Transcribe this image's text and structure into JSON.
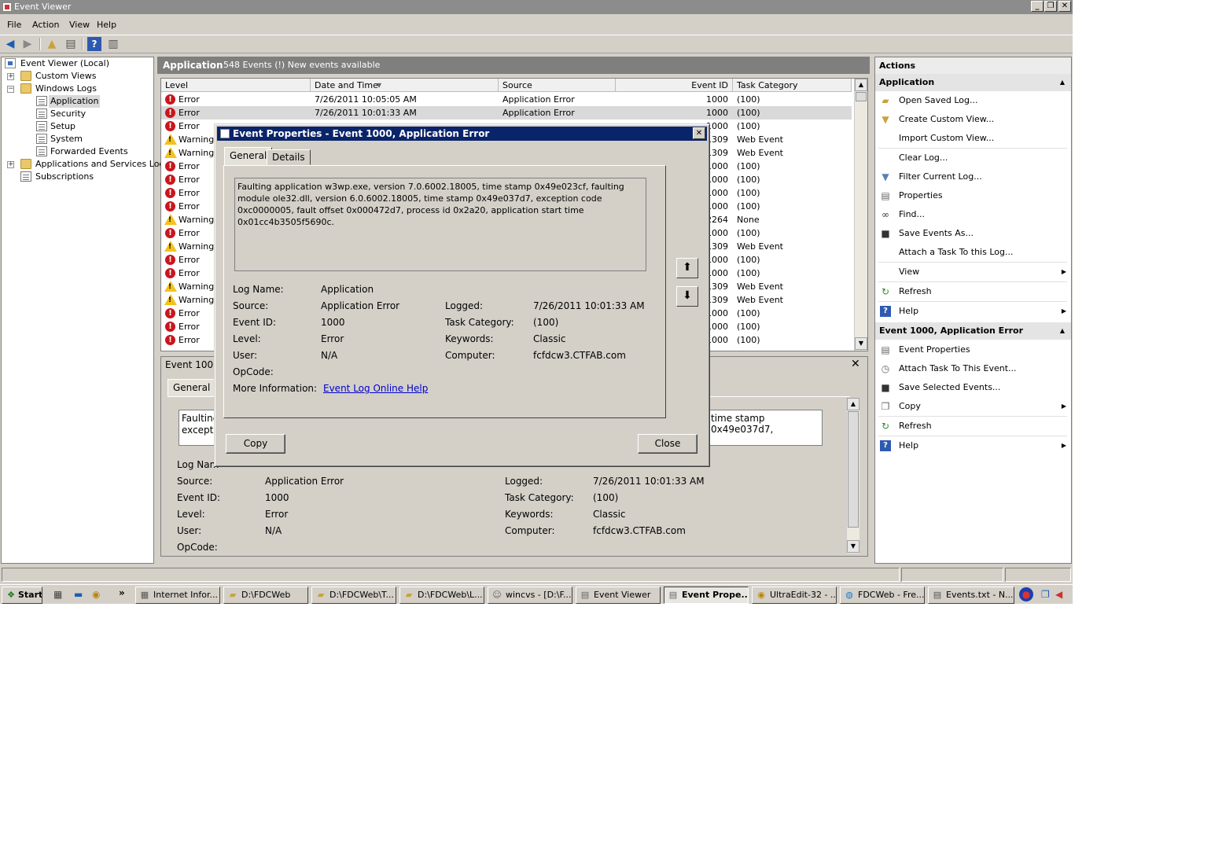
{
  "window": {
    "title": "Event Viewer"
  },
  "menu": [
    "File",
    "Action",
    "View",
    "Help"
  ],
  "tree": {
    "root": "Event Viewer (Local)",
    "custom_views": "Custom Views",
    "windows_logs": "Windows Logs",
    "logs": [
      "Application",
      "Security",
      "Setup",
      "System",
      "Forwarded Events"
    ],
    "apps_services": "Applications and Services Logs",
    "subscriptions": "Subscriptions"
  },
  "center": {
    "title": "Application",
    "subtitle": "548 Events (!) New events available"
  },
  "grid": {
    "columns": [
      "Level",
      "Date and Time",
      "Source",
      "Event ID",
      "Task Category"
    ],
    "rows": [
      {
        "level": "Error",
        "date": "7/26/2011 10:05:05 AM",
        "source": "Application Error",
        "id": "1000",
        "category": "(100)"
      },
      {
        "level": "Error",
        "date": "7/26/2011 10:01:33 AM",
        "source": "Application Error",
        "id": "1000",
        "category": "(100)"
      },
      {
        "level": "Error",
        "date": "",
        "source": "",
        "id": "1000",
        "category": "(100)"
      },
      {
        "level": "Warning",
        "date": "",
        "source": "",
        "id": "1309",
        "category": "Web Event"
      },
      {
        "level": "Warning",
        "date": "",
        "source": "",
        "id": "1309",
        "category": "Web Event"
      },
      {
        "level": "Error",
        "date": "",
        "source": "",
        "id": "1000",
        "category": "(100)"
      },
      {
        "level": "Error",
        "date": "",
        "source": "",
        "id": "1000",
        "category": "(100)"
      },
      {
        "level": "Error",
        "date": "",
        "source": "",
        "id": "1000",
        "category": "(100)"
      },
      {
        "level": "Error",
        "date": "",
        "source": "",
        "id": "1000",
        "category": "(100)"
      },
      {
        "level": "Warning",
        "date": "",
        "source": "",
        "id": "2264",
        "category": "None"
      },
      {
        "level": "Error",
        "date": "",
        "source": "",
        "id": "1000",
        "category": "(100)"
      },
      {
        "level": "Warning",
        "date": "",
        "source": "",
        "id": "1309",
        "category": "Web Event"
      },
      {
        "level": "Error",
        "date": "",
        "source": "",
        "id": "1000",
        "category": "(100)"
      },
      {
        "level": "Error",
        "date": "",
        "source": "",
        "id": "1000",
        "category": "(100)"
      },
      {
        "level": "Warning",
        "date": "",
        "source": "",
        "id": "1309",
        "category": "Web Event"
      },
      {
        "level": "Warning",
        "date": "",
        "source": "",
        "id": "1309",
        "category": "Web Event"
      },
      {
        "level": "Error",
        "date": "",
        "source": "",
        "id": "1000",
        "category": "(100)"
      },
      {
        "level": "Error",
        "date": "",
        "source": "",
        "id": "1000",
        "category": "(100)"
      },
      {
        "level": "Error",
        "date": "",
        "source": "",
        "id": "1000",
        "category": "(100)"
      }
    ]
  },
  "detail": {
    "header": "Event 1000,",
    "tab_general": "General",
    "desc_left": "Faulting\nexceptio",
    "desc_right": "time stamp 0x49e037d7,",
    "log_name_label": "Log Nam",
    "source_label": "Source:",
    "source": "Application Error",
    "event_id_label": "Event ID:",
    "event_id": "1000",
    "level_label": "Level:",
    "level": "Error",
    "user_label": "User:",
    "user": "N/A",
    "opcode_label": "OpCode:",
    "logged_label": "Logged:",
    "logged": "7/26/2011 10:01:33 AM",
    "task_label": "Task Category:",
    "task": "(100)",
    "keywords_label": "Keywords:",
    "keywords": "Classic",
    "computer_label": "Computer:",
    "computer": "fcfdcw3.CTFAB.com"
  },
  "actions": {
    "title": "Actions",
    "section1": "Application",
    "items1": [
      "Open Saved Log...",
      "Create Custom View...",
      "Import Custom View...",
      "Clear Log...",
      "Filter Current Log...",
      "Properties",
      "Find...",
      "Save Events As...",
      "Attach a Task To this Log...",
      "View",
      "Refresh",
      "Help"
    ],
    "section2": "Event 1000, Application Error",
    "items2": [
      "Event Properties",
      "Attach Task To This Event...",
      "Save Selected Events...",
      "Copy",
      "Refresh",
      "Help"
    ]
  },
  "dialog": {
    "title": "Event Properties - Event 1000, Application Error",
    "tabs": [
      "General",
      "Details"
    ],
    "description": "Faulting application w3wp.exe, version 7.0.6002.18005, time stamp 0x49e023cf, faulting module ole32.dll, version 6.0.6002.18005, time stamp 0x49e037d7, exception code 0xc0000005, fault offset 0x000472d7, process id 0x2a20, application start time 0x01cc4b3505f5690c.",
    "log_name_label": "Log Name:",
    "log_name": "Application",
    "source_label": "Source:",
    "source": "Application Error",
    "event_id_label": "Event ID:",
    "event_id": "1000",
    "level_label": "Level:",
    "level": "Error",
    "user_label": "User:",
    "user": "N/A",
    "opcode_label": "OpCode:",
    "more_info_label": "More Information:",
    "more_info_link": "Event Log Online Help",
    "logged_label": "Logged:",
    "logged": "7/26/2011 10:01:33 AM",
    "task_label": "Task Category:",
    "task": "(100)",
    "keywords_label": "Keywords:",
    "keywords": "Classic",
    "computer_label": "Computer:",
    "computer": "fcfdcw3.CTFAB.com",
    "copy_button": "Copy",
    "close_button": "Close"
  },
  "taskbar": {
    "start": "Start",
    "tasks": [
      "Internet Infor...",
      "D:\\FDCWeb",
      "D:\\FDCWeb\\T...",
      "D:\\FDCWeb\\L...",
      "wincvs - [D:\\F...",
      "Event Viewer",
      "Event Prope...",
      "UltraEdit-32 - ...",
      "FDCWeb - Fre...",
      "Events.txt - N..."
    ]
  },
  "colors": {
    "dialog_title": "#0a246a",
    "error": "#c8161d",
    "warning": "#f3c21c",
    "link": "#0000cc"
  }
}
